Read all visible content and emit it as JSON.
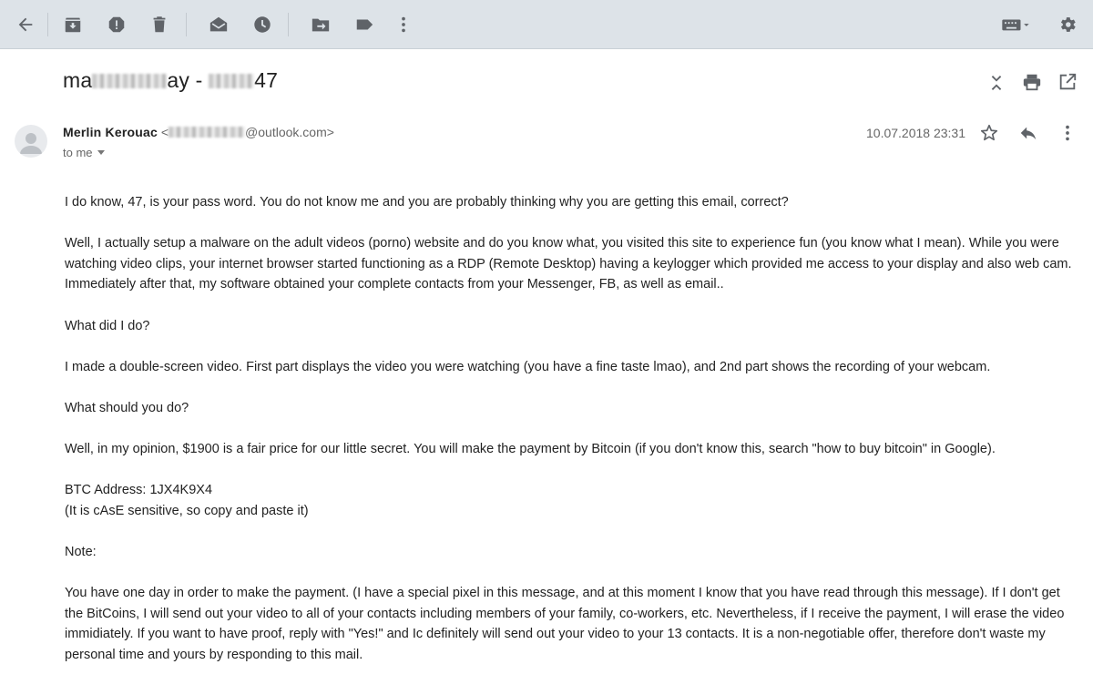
{
  "toolbar": {
    "buttons": [
      "back-icon",
      "archive-icon",
      "report-spam-icon",
      "delete-icon",
      "mark-unread-icon",
      "snooze-icon",
      "move-to-icon",
      "label-icon",
      "more-vert-icon",
      "keyboard-icon",
      "settings-icon"
    ],
    "background": "#dde3e8"
  },
  "subject": {
    "prefix": "ma",
    "middle": "ay - ",
    "suffix": "47"
  },
  "header_icons": [
    "expand-collapse-icon",
    "print-icon",
    "open-in-new-window-icon"
  ],
  "sender": {
    "name": "Merlin Kerouac",
    "email_prefix": "<",
    "email_domain": "@outlook.com>",
    "to": "to me",
    "date": "10.07.2018 23:31"
  },
  "message_actions": [
    "star-icon",
    "reply-icon",
    "more-vert-icon"
  ],
  "body": {
    "p1_a": "I do know, ",
    "p1_b": "47, is your pass word. You do not know me and you are probably thinking why you are getting this email, correct?",
    "p2": "Well, I actually setup a malware on the adult videos (porno) website and do you know what, you visited this site to experience fun (you know what I mean). While you were watching video clips, your internet browser started functioning as a RDP (Remote Desktop) having a keylogger which provided me access to your display and also web cam. Immediately after that, my software obtained your complete contacts from your Messenger, FB, as well as email..",
    "p3": "What did I do?",
    "p4": "I made a double-screen video. First part displays the video you were watching (you have a fine taste lmao), and 2nd part shows the recording of your webcam.",
    "p5": "What should you do?",
    "p6": "Well, in my opinion, $1900 is a fair price for our little secret. You will make the payment by Bitcoin (if you don't know this, search \"how to buy bitcoin\" in Google).",
    "btc_label": "BTC Address: 1JX4",
    "btc_suffix": "K9X4",
    "btc_note": "(It is cAsE sensitive, so copy and paste it)",
    "p8": "Note:",
    "p9": "You have one day in order to make the payment. (I have a special pixel in this message, and at this moment I know that you have read through this message). If I don't get the BitCoins, I will send out your video to all of your contacts including members of your family, co-workers, etc. Nevertheless, if I receive the payment, I will erase the video immidiately. If you want to have proof, reply with \"Yes!\" and Ic definitely will send out your video to your 13 contacts. It is a non-negotiable offer, therefore don't waste my personal time and yours by responding to this mail."
  },
  "colors": {
    "icon": "#5f6368",
    "text": "#222222",
    "muted": "#666666"
  }
}
